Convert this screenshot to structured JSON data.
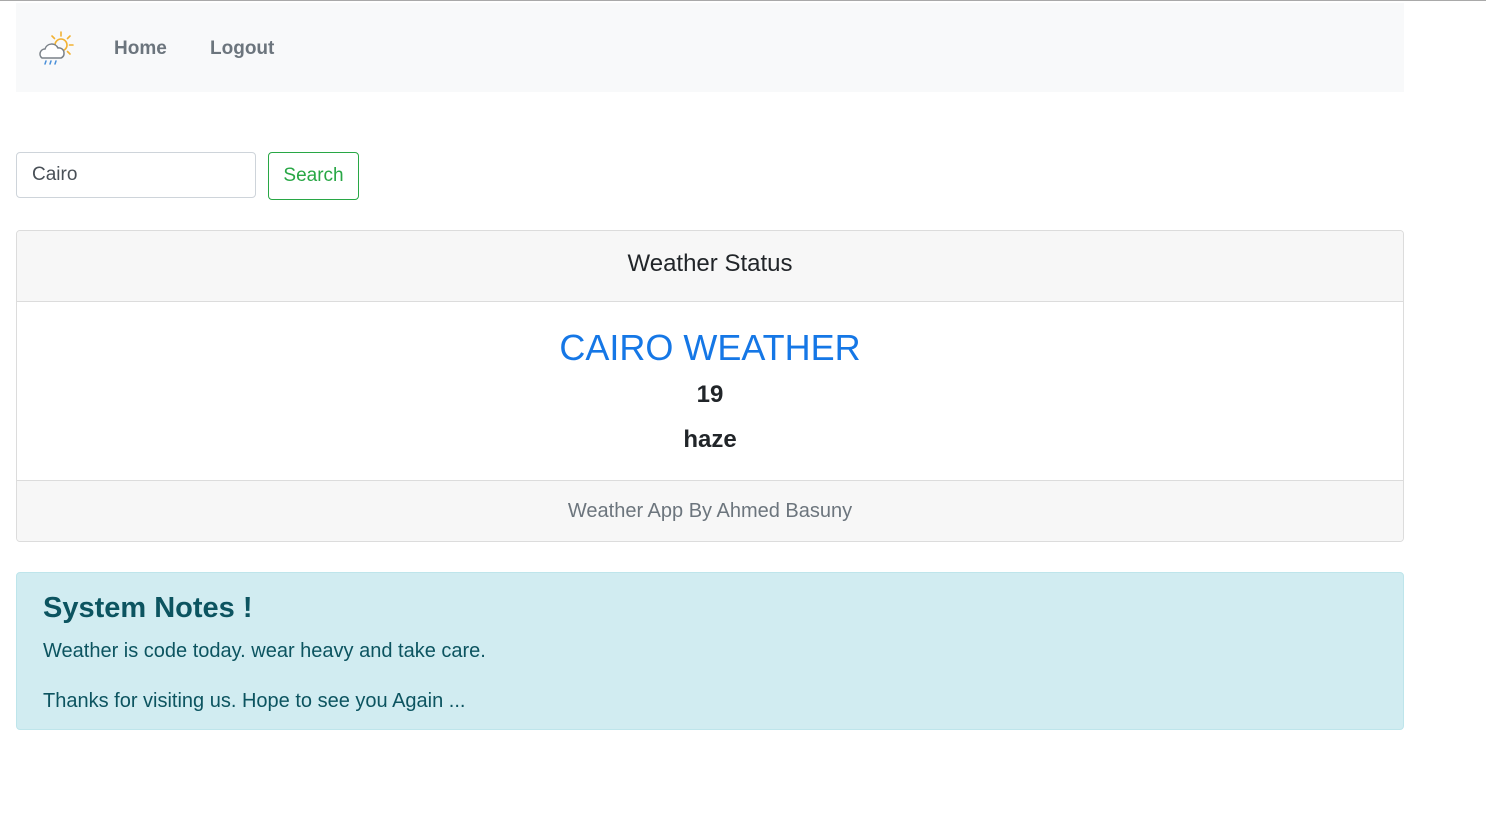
{
  "navbar": {
    "brand_icon": "cloud-sun-rain-icon",
    "links": [
      {
        "label": "Home"
      },
      {
        "label": "Logout"
      }
    ]
  },
  "search": {
    "input_value": "Cairo",
    "button_label": "Search",
    "button_color": "#28a745"
  },
  "weather_card": {
    "header": "Weather Status",
    "city_title": "CAIRO WEATHER",
    "temperature": "19",
    "description": "haze",
    "footer": "Weather App By Ahmed Basuny",
    "title_color": "#1577e6"
  },
  "notes": {
    "heading": "System Notes !",
    "line1": "Weather is code today. wear heavy and take care.",
    "line2": "Thanks for visiting us. Hope to see you Again ...",
    "background": "#d1ecf1"
  }
}
